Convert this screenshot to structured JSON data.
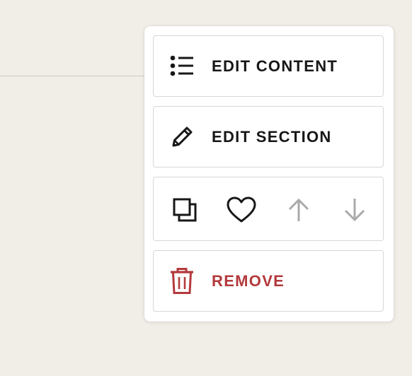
{
  "menu": {
    "edit_content_label": "EDIT CONTENT",
    "edit_section_label": "EDIT SECTION",
    "remove_label": "REMOVE",
    "icons": {
      "edit_content": "list-icon",
      "edit_section": "pencil-icon",
      "duplicate": "duplicate-icon",
      "favorite": "heart-icon",
      "move_up": "arrow-up-icon",
      "move_down": "arrow-down-icon",
      "remove": "trash-icon"
    },
    "states": {
      "move_up_enabled": false,
      "move_down_enabled": false
    }
  },
  "colors": {
    "background": "#f1ede7",
    "panel": "#ffffff",
    "text": "#171717",
    "danger": "#b3393c",
    "disabled_icon": "#aaaaaa",
    "card_border": "#d7d7d7"
  }
}
